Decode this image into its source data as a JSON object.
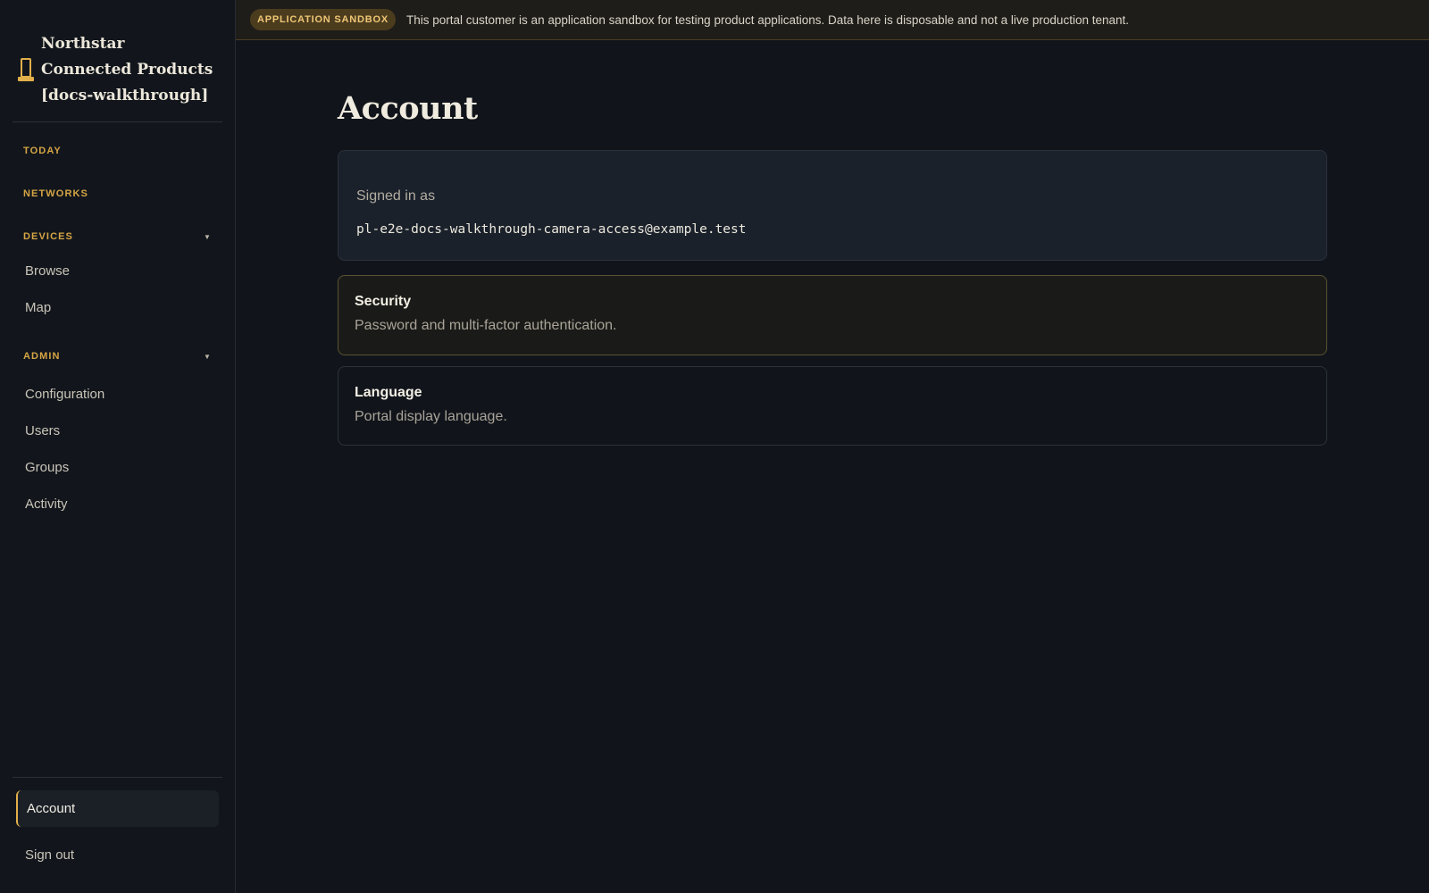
{
  "brand": {
    "name": "Northstar Connected Products [docs-walkthrough]",
    "icon": "tower-icon"
  },
  "banner": {
    "badge": "APPLICATION SANDBOX",
    "text": "This portal customer is an application sandbox for testing product applications. Data here is disposable and not a live production tenant."
  },
  "nav": {
    "today": "TODAY",
    "networks": "NETWORKS",
    "devices": {
      "label": "DEVICES",
      "items": [
        "Browse",
        "Map"
      ]
    },
    "admin": {
      "label": "ADMIN",
      "items": [
        "Configuration",
        "Users",
        "Groups",
        "Activity"
      ]
    }
  },
  "footer": {
    "account": "Account",
    "signout": "Sign out"
  },
  "page": {
    "title": "Account",
    "signed_in": {
      "label": "Signed in as",
      "email": "pl-e2e-docs-walkthrough-camera-access@example.test"
    },
    "security": {
      "title": "Security",
      "desc": "Password and multi-factor authentication."
    },
    "language": {
      "title": "Language",
      "desc": "Portal display language."
    }
  },
  "colors": {
    "accent": "#e2b04a",
    "background": "#11151b",
    "sidebar": "#12161c"
  }
}
